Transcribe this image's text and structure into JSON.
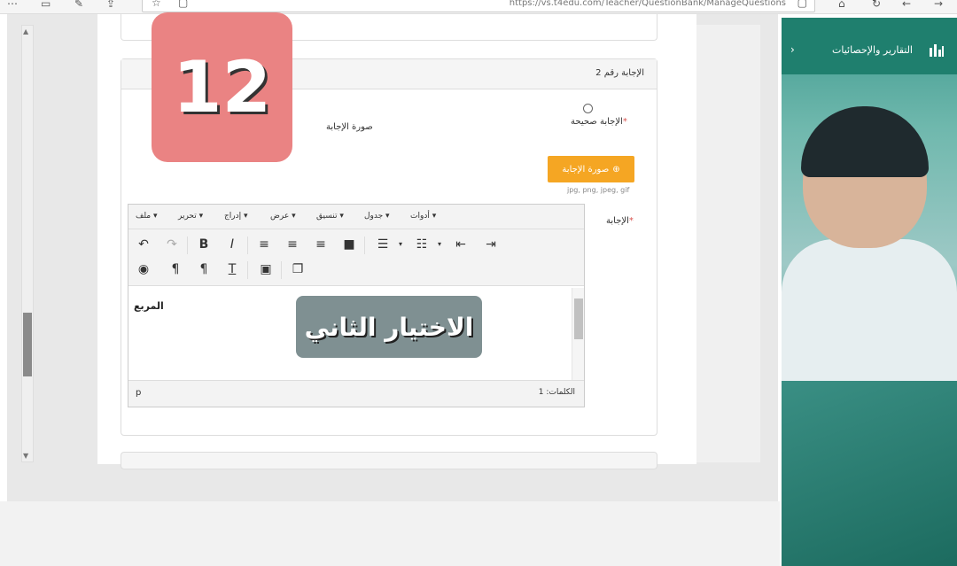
{
  "browser": {
    "url": "https://vs.t4edu.com/Teacher/QuestionBank/ManageQuestions",
    "icons": [
      "more-icon",
      "reading-list-icon",
      "pen-icon",
      "share-icon",
      "star-icon",
      "tab-icon",
      "home-icon",
      "refresh-icon",
      "back-icon",
      "forward-icon"
    ]
  },
  "badge": {
    "number": "12",
    "color": "#ea8383"
  },
  "overlay": {
    "text": "الاختيار الثاني",
    "color": "#7f9092"
  },
  "card": {
    "title": "الإجابة رقم 2",
    "correct_label": "الإجابة صحيحة",
    "image_label": "صورة الإجابة",
    "upload_button": "صورة الإجابة",
    "upload_hint": "jpg, png, jpeg, gif",
    "answer_label": "الإجابة"
  },
  "editor": {
    "menus": [
      "ملف",
      "تحرير",
      "إدراج",
      "عرض",
      "تنسيق",
      "جدول",
      "أدوات"
    ],
    "content": "المربع",
    "status_path": "p",
    "word_count": "الكلمات: 1"
  },
  "sidebar": {
    "title": "التقارير والإحصائيات",
    "accent": "#1f7f6e"
  },
  "colors": {
    "orange": "#f5a623",
    "required": "#d9534f"
  }
}
